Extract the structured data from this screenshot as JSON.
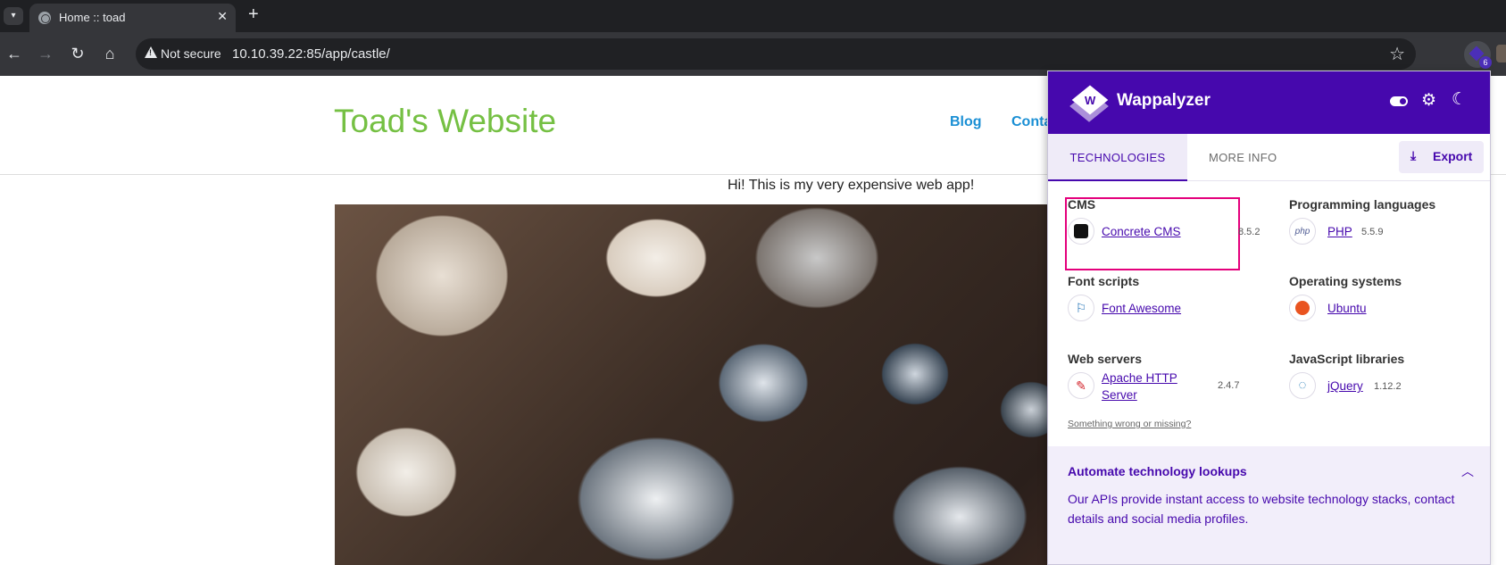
{
  "browser": {
    "tab_title": "Home :: toad",
    "security_label": "Not secure",
    "url": "10.10.39.22:85/app/castle/",
    "extension_badge": "6"
  },
  "site": {
    "title": "Toad's Website",
    "nav": [
      "Blog",
      "Contac"
    ],
    "intro": "Hi! This is my very expensive web app!"
  },
  "wappalyzer": {
    "brand": "Wappalyzer",
    "tabs": {
      "technologies": "TECHNOLOGIES",
      "more_info": "MORE INFO"
    },
    "export_label": "Export",
    "categories": [
      {
        "title": "CMS",
        "tech": [
          {
            "name": "Concrete CMS",
            "version": "8.5.2",
            "icon": "concrete-cms-icon"
          }
        ]
      },
      {
        "title": "Programming languages",
        "tech": [
          {
            "name": "PHP",
            "version": "5.5.9",
            "icon": "php-icon"
          }
        ]
      },
      {
        "title": "Font scripts",
        "tech": [
          {
            "name": "Font Awesome",
            "version": "",
            "icon": "flag-icon"
          }
        ]
      },
      {
        "title": "Operating systems",
        "tech": [
          {
            "name": "Ubuntu",
            "version": "",
            "icon": "ubuntu-icon"
          }
        ]
      },
      {
        "title": "Web servers",
        "tech": [
          {
            "name": "Apache HTTP Server",
            "name_line1": "Apache HTTP",
            "name_line2": "Server",
            "version": "2.4.7",
            "icon": "apache-feather-icon"
          }
        ]
      },
      {
        "title": "JavaScript libraries",
        "tech": [
          {
            "name": "jQuery",
            "version": "1.12.2",
            "icon": "jquery-icon"
          }
        ]
      }
    ],
    "wrong_link": "Something wrong or missing?",
    "promo": {
      "title": "Automate technology lookups",
      "body": "Our APIs provide instant access to website technology stacks, contact details and social media profiles."
    },
    "highlight_color": "#e4007c",
    "accent_color": "#4608ad"
  }
}
